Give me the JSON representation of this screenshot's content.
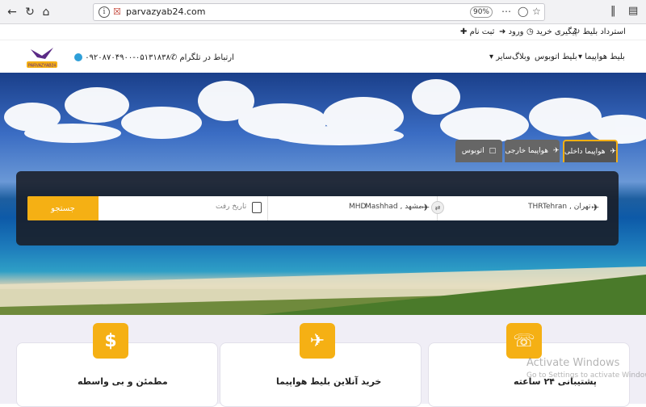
{
  "browser": {
    "url": "parvazyab24.com",
    "zoom": "90%"
  },
  "topbar": {
    "refund": "استرداد بلیط",
    "track": "پیگیری خرید",
    "login": "ورود",
    "register": "ثبت نام"
  },
  "header": {
    "logo_text": "PARVAZYAB24",
    "menu": {
      "flight": "بلیط هواپیما",
      "bus": "بلیط اتوبوس",
      "blog": "وبلاگ",
      "other": "سایر"
    },
    "contact_phone": "۰۵۱۳۱۸۳۸-۰۹۲۰۸۷۰۴۹۰۰",
    "contact_telegram": "ارتباط در تلگرام"
  },
  "search": {
    "tabs": {
      "domestic": "هواپیما داخلی",
      "foreign": "هواپیما خارجی",
      "bus": "اتوبوس"
    },
    "from_value": "Tehran , تهران",
    "from_code": "THR",
    "to_value": "Mashhad , مشهد",
    "to_code": "MHD",
    "date_placeholder": "تاریخ رفت",
    "button": "جستجو"
  },
  "features": {
    "card1": "مطمئن و بی واسطه",
    "card2": "خرید آنلاین بلیط هواپیما",
    "card3": "پشتیبانی ۲۴ ساعته"
  },
  "watermark": {
    "line1": "Activate Windows",
    "line2": "Go to Settings to activate Windows."
  },
  "colors": {
    "accent": "#f5b014",
    "panel": "#1c1f28"
  }
}
